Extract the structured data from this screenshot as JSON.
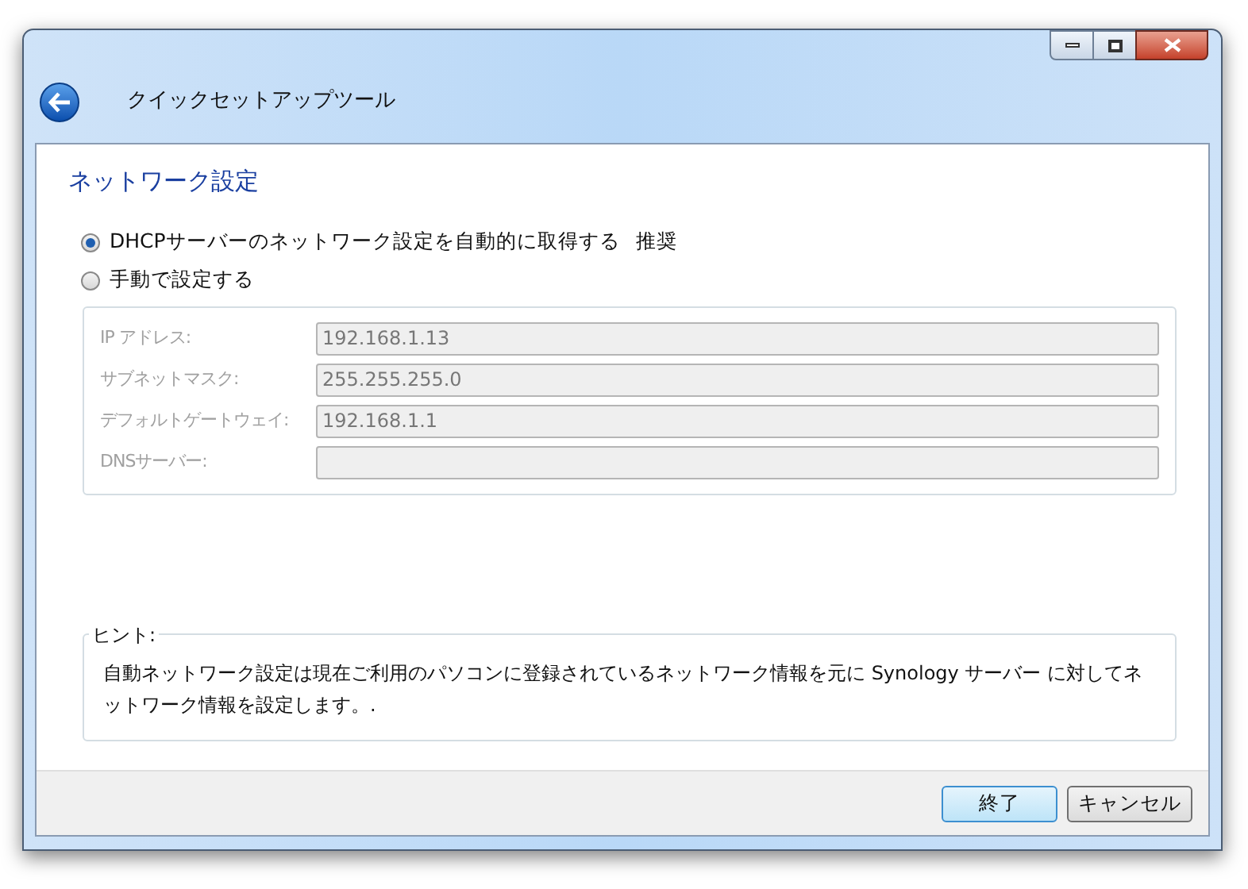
{
  "window": {
    "title": "クイックセットアップツール"
  },
  "heading": "ネットワーク設定",
  "options": [
    {
      "label": "DHCPサーバーのネットワーク設定を自動的に取得する",
      "note": "推奨",
      "selected": true
    },
    {
      "label": "手動で設定する",
      "selected": false
    }
  ],
  "manual": {
    "disabled": true,
    "fields": [
      {
        "label": "IP アドレス:",
        "value": "192.168.1.13"
      },
      {
        "label": "サブネットマスク:",
        "value": "255.255.255.0"
      },
      {
        "label": "デフォルトゲートウェイ:",
        "value": "192.168.1.1"
      },
      {
        "label": "DNSサーバー:"
      }
    ]
  },
  "hint": {
    "title": "ヒント:",
    "text": "自動ネットワーク設定は現在ご利用のパソコンに登録されているネットワーク情報を元に Synology サーバー に対してネットワーク情報を設定します。."
  },
  "buttons": [
    {
      "label": "終了",
      "default": true
    },
    {
      "label": "キャンセル",
      "default": false
    }
  ]
}
